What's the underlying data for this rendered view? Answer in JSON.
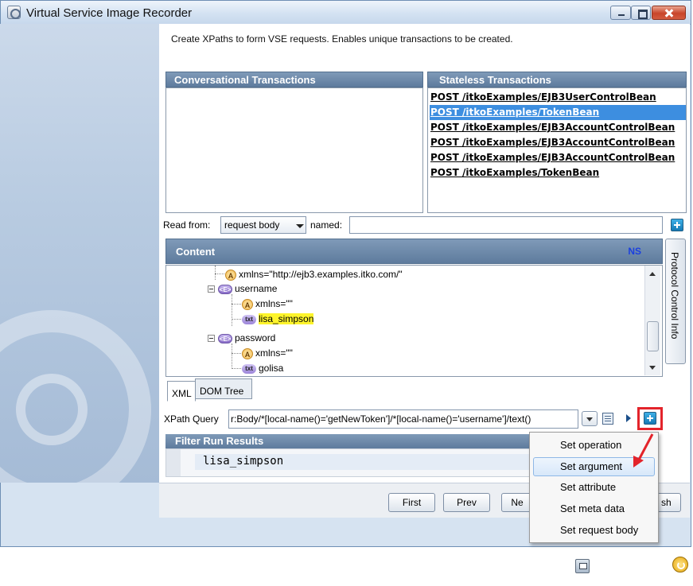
{
  "window": {
    "title": "Virtual Service Image Recorder"
  },
  "description": "Create XPaths to form VSE requests.  Enables unique transactions to be created.",
  "conversational": {
    "header": "Conversational Transactions",
    "items": []
  },
  "stateless": {
    "header": "Stateless Transactions",
    "items": [
      "POST /itkoExamples/EJB3UserControlBean",
      "POST /itkoExamples/TokenBean",
      "POST /itkoExamples/EJB3AccountControlBean",
      "POST /itkoExamples/EJB3AccountControlBean",
      "POST /itkoExamples/EJB3AccountControlBean",
      "POST /itkoExamples/TokenBean"
    ],
    "selected_index": 1
  },
  "read_from": {
    "label": "Read from:",
    "value": "request body",
    "named_label": "named:",
    "named_value": ""
  },
  "content": {
    "header": "Content",
    "ns_label": "NS",
    "tree": [
      {
        "badge": "A",
        "text": "xmlns=\"http://ejb3.examples.itko.com/\""
      },
      {
        "badge": "<E>",
        "text": "username"
      },
      {
        "badge": "A",
        "text": "xmlns=\"\""
      },
      {
        "badge": "txt",
        "text": "lisa_simpson",
        "highlighted": true
      },
      {
        "badge": "<E>",
        "text": "password"
      },
      {
        "badge": "A",
        "text": "xmlns=\"\""
      },
      {
        "badge": "txt",
        "text": "golisa"
      }
    ],
    "tabs": [
      "XML",
      "DOM Tree"
    ],
    "active_tab": "XML",
    "side_tab": "Protocol Control Info"
  },
  "xpath": {
    "label": "XPath Query",
    "value": "r:Body/*[local-name()='getNewToken']/*[local-name()='username']/text()"
  },
  "filter": {
    "header": "Filter Run Results",
    "result": "lisa_simpson"
  },
  "nav_buttons": {
    "first": "First",
    "prev": "Prev",
    "next": "Ne",
    "finish": "sh"
  },
  "popup_menu": {
    "items": [
      "Set operation",
      "Set argument",
      "Set attribute",
      "Set meta data",
      "Set request body"
    ],
    "hover_index": 1
  },
  "colors": {
    "panel_header": "#6f8cad",
    "selection": "#3d8ee0",
    "highlight": "#fdf42c",
    "callout": "#e3242b"
  },
  "icons": {
    "window": "recorder-app-icon",
    "add": "plus-icon",
    "save": "save-icon",
    "refresh": "refresh-icon"
  }
}
